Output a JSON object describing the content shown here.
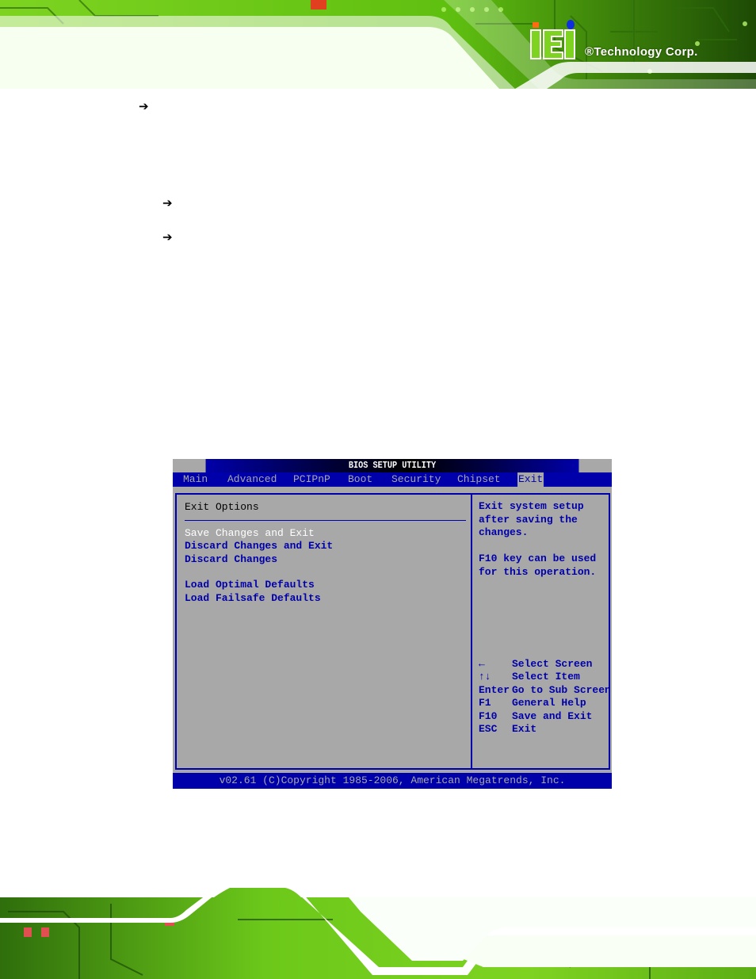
{
  "header": {
    "brand_name": "®Technology Corp.",
    "logo": "iei-logo",
    "brand_colors": {
      "green": "#7ed321",
      "dark_green": "#1a3a00",
      "logo_orange": "#ff6a13",
      "logo_blue": "#1030e0"
    }
  },
  "bullets": [
    {
      "icon": "arrow-right-icon"
    },
    {
      "icon": "arrow-right-icon"
    },
    {
      "icon": "arrow-right-icon"
    }
  ],
  "bios": {
    "title": "BIOS SETUP UTILITY",
    "tabs": [
      {
        "label": "Main",
        "active": false
      },
      {
        "label": "Advanced",
        "active": false
      },
      {
        "label": "PCIPnP",
        "active": false
      },
      {
        "label": "Boot",
        "active": false
      },
      {
        "label": "Security",
        "active": false
      },
      {
        "label": "Chipset",
        "active": false
      },
      {
        "label": "Exit",
        "active": true
      }
    ],
    "section_title": "Exit Options",
    "menu_items": [
      {
        "label": "Save Changes and Exit",
        "selected": true
      },
      {
        "label": "Discard Changes and Exit",
        "selected": false
      },
      {
        "label": "Discard Changes",
        "selected": false
      },
      {
        "label": "Load Optimal Defaults",
        "selected": false
      },
      {
        "label": "Load Failsafe Defaults",
        "selected": false
      }
    ],
    "help_text": [
      "Exit system setup",
      "after saving the",
      "changes.",
      "",
      "F10 key can be used",
      "for this operation."
    ],
    "key_legend": [
      {
        "key": "←",
        "action": "Select Screen"
      },
      {
        "key": "↑↓",
        "action": "Select Item"
      },
      {
        "key": "Enter",
        "action": "Go to Sub Screen"
      },
      {
        "key": "F1",
        "action": "General Help"
      },
      {
        "key": "F10",
        "action": "Save and Exit"
      },
      {
        "key": "ESC",
        "action": "Exit"
      }
    ],
    "footer": "v02.61 (C)Copyright 1985-2006, American Megatrends, Inc.",
    "colors": {
      "blue": "#0000aa",
      "gray": "#a8a8a8",
      "white": "#ffffff"
    }
  }
}
